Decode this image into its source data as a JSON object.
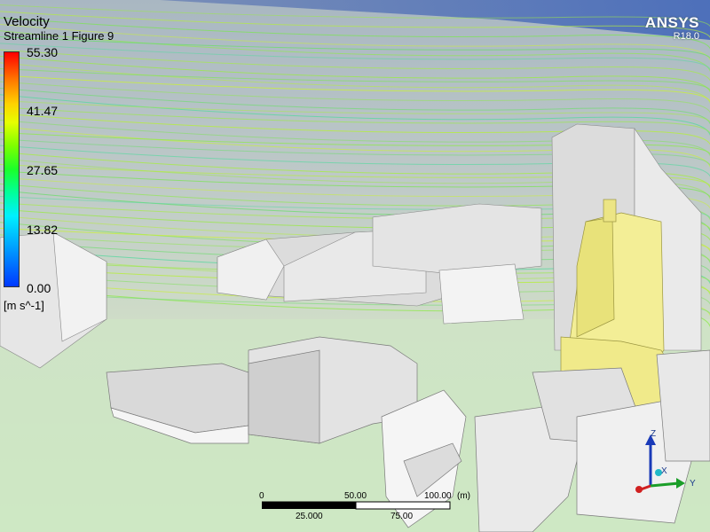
{
  "legend": {
    "title": "Velocity",
    "subtitle": "Streamline 1 Figure 9",
    "ticks": [
      "55.30",
      "41.47",
      "27.65",
      "13.82",
      "0.00"
    ],
    "units": "[m s^-1]"
  },
  "brand": {
    "name": "ANSYS",
    "version": "R18.0"
  },
  "scale": {
    "top_labels": [
      "0",
      "50.00",
      "100.00",
      "(m)"
    ],
    "bottom_labels": [
      "25.000",
      "75.00"
    ]
  },
  "axes": {
    "x": "X",
    "y": "Y",
    "z": "Z"
  },
  "colors": {
    "sky_top": "#9aa9b9",
    "ground": "#cfe8c4",
    "highlight_building": "#f3ee96",
    "building": "#e8e8e8"
  }
}
